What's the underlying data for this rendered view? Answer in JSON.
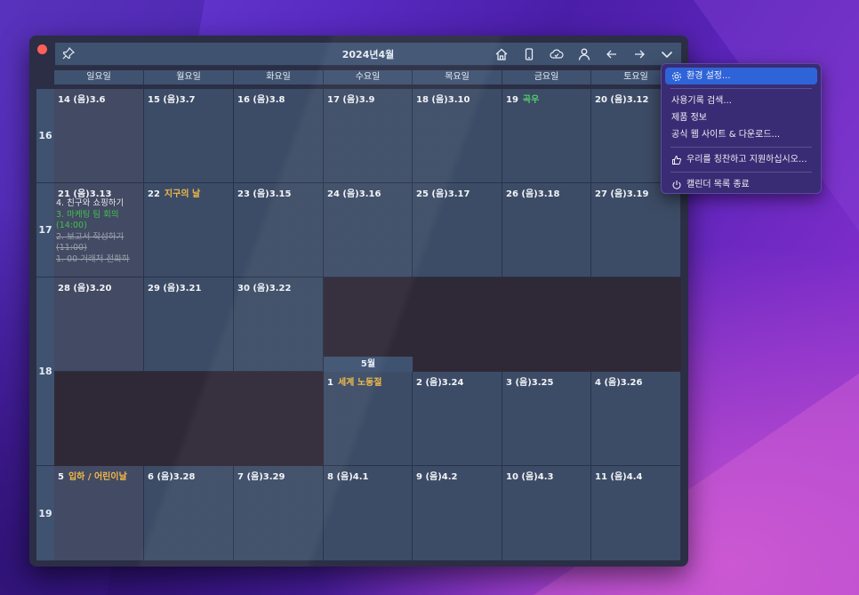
{
  "window": {
    "title": "2024년4월"
  },
  "toolbar": {
    "icons": [
      "pin-icon",
      "home-icon",
      "phone-icon",
      "cloud-check-icon",
      "person-icon",
      "arrow-left-icon",
      "arrow-right-icon",
      "chevron-down-icon"
    ]
  },
  "weekdays": [
    "일요일",
    "월요일",
    "화요일",
    "수요일",
    "목요일",
    "금요일",
    "토요일"
  ],
  "weeks": [
    {
      "num": "16",
      "days": [
        {
          "date": "14",
          "lunar": "(음)3.6"
        },
        {
          "date": "15",
          "lunar": "(음)3.7"
        },
        {
          "date": "16",
          "lunar": "(음)3.8"
        },
        {
          "date": "17",
          "lunar": "(음)3.9"
        },
        {
          "date": "18",
          "lunar": "(음)3.10"
        },
        {
          "date": "19",
          "lunar": "",
          "solar": "곡우"
        },
        {
          "date": "20",
          "lunar": "(음)3.12"
        }
      ]
    },
    {
      "num": "17",
      "days": [
        {
          "date": "21",
          "lunar": "(음)3.13"
        },
        {
          "date": "22",
          "lunar": "",
          "holiday": "지구의 날"
        },
        {
          "date": "23",
          "lunar": "(음)3.15"
        },
        {
          "date": "24",
          "lunar": "(음)3.16"
        },
        {
          "date": "25",
          "lunar": "(음)3.17"
        },
        {
          "date": "26",
          "lunar": "(음)3.18"
        },
        {
          "date": "27",
          "lunar": "(음)3.19"
        }
      ]
    },
    {
      "num": "18",
      "days_april": [
        {
          "date": "28",
          "lunar": "(음)3.20"
        },
        {
          "date": "29",
          "lunar": "(음)3.21"
        },
        {
          "date": "30",
          "lunar": "(음)3.22"
        }
      ],
      "month_label": "5월",
      "days_may": [
        {
          "date": "1",
          "lunar": "",
          "holiday": "세계 노동절"
        },
        {
          "date": "2",
          "lunar": "(음)3.24"
        },
        {
          "date": "3",
          "lunar": "(음)3.25"
        },
        {
          "date": "4",
          "lunar": "(음)3.26"
        }
      ]
    },
    {
      "num": "19",
      "days": [
        {
          "date": "5",
          "lunar": "",
          "holiday": "입하 / 어린이날"
        },
        {
          "date": "6",
          "lunar": "(음)3.28"
        },
        {
          "date": "7",
          "lunar": "(음)3.29"
        },
        {
          "date": "8",
          "lunar": "(음)4.1"
        },
        {
          "date": "9",
          "lunar": "(음)4.2"
        },
        {
          "date": "10",
          "lunar": "(음)4.3"
        },
        {
          "date": "11",
          "lunar": "(음)4.4"
        }
      ]
    }
  ],
  "events_21": [
    {
      "text": "4. 친구와 쇼핑하기",
      "style": "white"
    },
    {
      "text": "3. 마케팅 팀 회의",
      "style": "green"
    },
    {
      "text": "(14:00)",
      "style": "green"
    },
    {
      "text": "2. 보고서 작성하기",
      "style": "done"
    },
    {
      "text": "(11:00)",
      "style": "done"
    },
    {
      "text": "1. 00 거래처 전화하",
      "style": "done"
    }
  ],
  "menu": {
    "items": [
      {
        "label": "환경 설정...",
        "icon": "gear-icon",
        "active": true
      },
      {
        "label": "사용기록 검색...",
        "icon": ""
      },
      {
        "label": "제품 정보",
        "icon": ""
      },
      {
        "label": "공식 웹 사이트 & 다운로드...",
        "icon": ""
      },
      {
        "label": "우리를 칭찬하고 지원하십시오...",
        "icon": "thumbs-up-icon"
      },
      {
        "label": "캘린더 목록 종료",
        "icon": "power-icon"
      }
    ]
  },
  "colors": {
    "accent": "#2f63d8",
    "holiday": "#f0b848",
    "solar_term": "#4ecf6a",
    "cell": "#3d4c66",
    "header": "#3f5270"
  }
}
